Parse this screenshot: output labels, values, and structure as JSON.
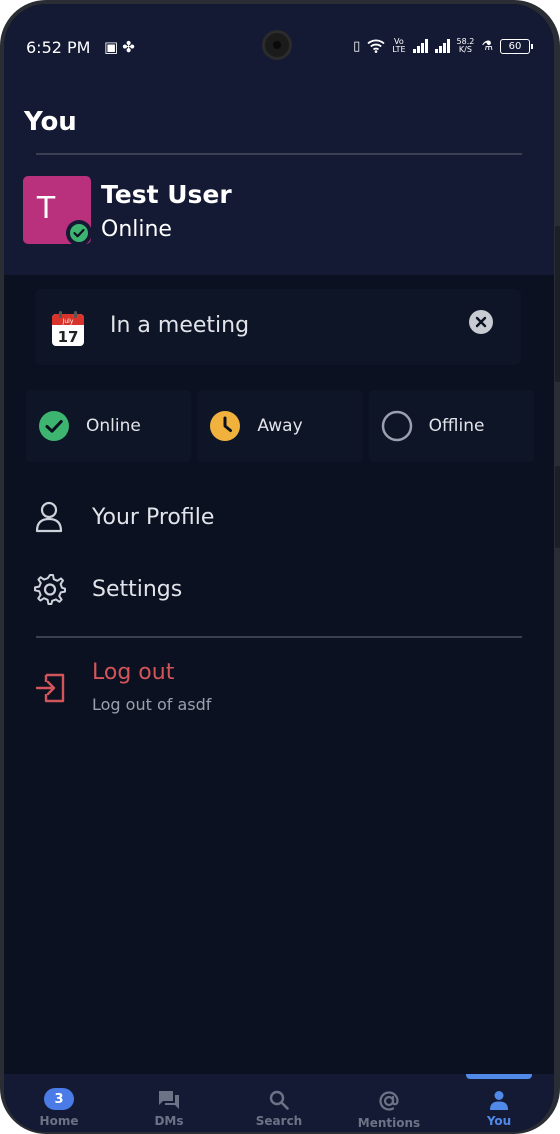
{
  "status_bar": {
    "time": "6:52 PM",
    "volte_top": "Vo",
    "volte_bottom": "LTE",
    "net_speed_value": "58.2",
    "net_speed_unit": "K/S",
    "battery": "60"
  },
  "header": {
    "title": "You"
  },
  "user": {
    "initial": "T",
    "name": "Test User",
    "status": "Online",
    "avatar_color": "#b9307c"
  },
  "custom_status": {
    "calendar_month": "July",
    "calendar_day": "17",
    "text": "In a meeting"
  },
  "presence_options": [
    {
      "label": "Online",
      "color": "#3db46f"
    },
    {
      "label": "Away",
      "color": "#f0b23c"
    },
    {
      "label": "Offline",
      "color": "#9aa0ad"
    }
  ],
  "menu": {
    "profile_label": "Your Profile",
    "settings_label": "Settings",
    "logout_label": "Log out",
    "logout_sub": "Log out of asdf"
  },
  "bottom_nav": {
    "home_badge": "3",
    "items": [
      {
        "label": "Home"
      },
      {
        "label": "DMs"
      },
      {
        "label": "Search"
      },
      {
        "label": "Mentions"
      },
      {
        "label": "You"
      }
    ],
    "accent": "#5089e8"
  }
}
